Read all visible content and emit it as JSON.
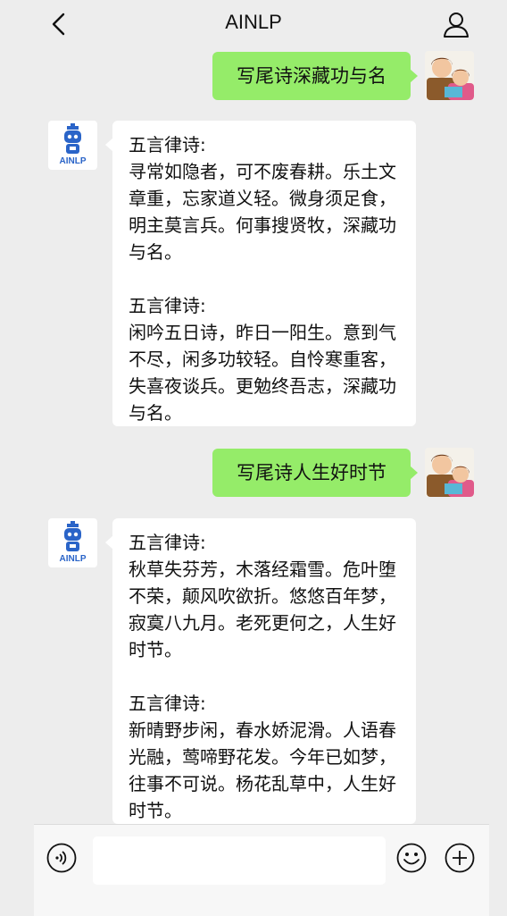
{
  "header": {
    "title": "AINLP"
  },
  "conversation": [
    {
      "role": "user",
      "text": "写尾诗深藏功与名"
    },
    {
      "role": "bot",
      "poems": [
        {
          "form": "五言律诗:",
          "text": "寻常如隐者，可不废春耕。乐土文章重，忘家道义轻。微身须足食，明主莫言兵。何事搜贤牧，深藏功与名。"
        },
        {
          "form": "五言律诗:",
          "text": "闲吟五日诗，昨日一阳生。意到气不尽，闲多功较轻。自怜寒重客，失喜夜谈兵。更勉终吾志，深藏功与名。"
        }
      ]
    },
    {
      "role": "user",
      "text": "写尾诗人生好时节"
    },
    {
      "role": "bot",
      "poems": [
        {
          "form": "五言律诗:",
          "text": "秋草失芬芳，木落经霜雪。危叶堕不荣，颠风吹欲折。悠悠百年梦，寂寞八九月。老死更何之，人生好时节。"
        },
        {
          "form": "五言律诗:",
          "text": "新晴野步闲，春水娇泥滑。人语春光融，莺啼野花发。今年已如梦，往事不可说。杨花乱草中，人生好时节。"
        }
      ]
    }
  ],
  "bot_avatar": {
    "logo_text": "AINLP"
  },
  "colors": {
    "user_bubble": "#95ec69",
    "bot_bubble": "#ffffff",
    "background": "#ededed",
    "bot_logo": "#2a64c8"
  }
}
